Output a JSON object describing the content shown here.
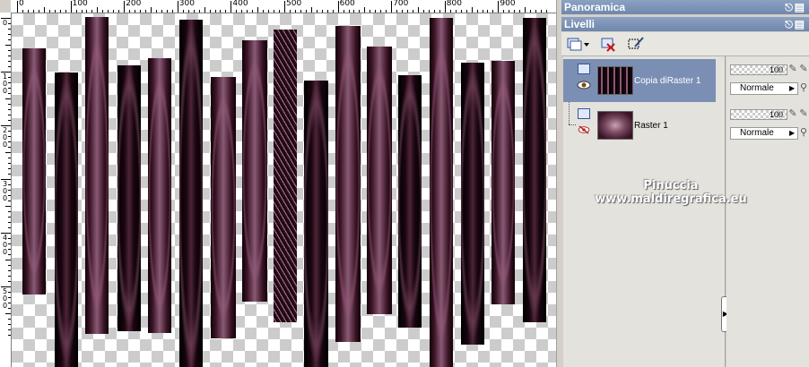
{
  "ruler": {
    "top_labels": [
      "0",
      "100",
      "200",
      "300",
      "400",
      "500",
      "600",
      "700",
      "800",
      "900"
    ],
    "left_labels": [
      "0",
      "1\n0\n0",
      "2\n0\n0",
      "3\n0\n0",
      "4\n0\n0",
      "5\n0\n0"
    ]
  },
  "panels": {
    "overview_title": "Panoramica",
    "layers_title": "Livelli",
    "pin_glyph": "╠",
    "close_glyph": "×"
  },
  "layers": [
    {
      "name": "Copia diRaster 1",
      "opacity": "100",
      "blend": "Normale",
      "selected": true
    },
    {
      "name": "Raster 1",
      "opacity": "100",
      "blend": "Normale",
      "selected": false
    }
  ],
  "watermark": {
    "line1": "Pinuccia",
    "line2": "www.maldiregrafica.eu"
  },
  "colors": {
    "selection": "#7b8fb4",
    "title_bar": "#6f87ad",
    "strip_dark": "#120008",
    "strip_light": "#8a5a75"
  }
}
